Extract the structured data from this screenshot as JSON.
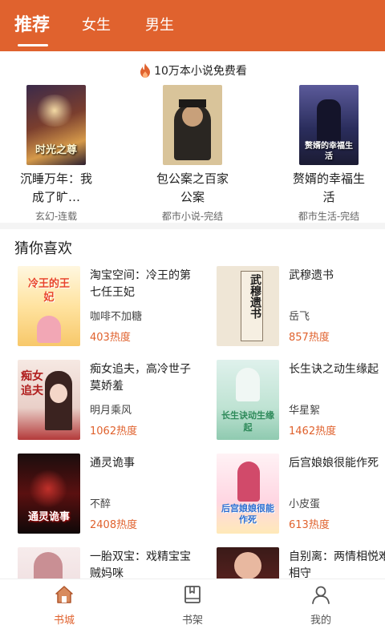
{
  "header": {
    "tabs": [
      {
        "label": "推荐",
        "active": true
      },
      {
        "label": "女生",
        "active": false
      },
      {
        "label": "男生",
        "active": false
      }
    ],
    "color": "#e0622e"
  },
  "promo": {
    "text": "10万本小说免费看",
    "icon": "flame-icon"
  },
  "featured": [
    {
      "title": "沉睡万年：我成了旷…",
      "meta": "玄幻-连载"
    },
    {
      "title": "包公案之百家公案",
      "meta": "都市小说-完结"
    },
    {
      "title": "赘婿的幸福生活",
      "meta": "都市生活-完结"
    }
  ],
  "section": {
    "title": "猜你喜欢"
  },
  "books": [
    {
      "title": "淘宝空间：冷王的第七任王妃",
      "author": "咖啡不加糖",
      "heat": "403热度"
    },
    {
      "title": "武穆遗书",
      "author": "岳飞",
      "heat": "857热度"
    },
    {
      "title": "痴女追夫，高冷世子莫娇羞",
      "author": "明月乘风",
      "heat": "1062热度"
    },
    {
      "title": "长生诀之动生缘起",
      "author": "华星絮",
      "heat": "1462热度"
    },
    {
      "title": "通灵诡事",
      "author": "不醉",
      "heat": "2408热度"
    },
    {
      "title": "后宫娘娘很能作死",
      "author": "小皮蛋",
      "heat": "613热度"
    },
    {
      "title": "一胎双宝：戏精宝宝贼妈咪",
      "author": "",
      "heat": ""
    },
    {
      "title": "自别离：两情相悦难相守",
      "author": "",
      "heat": ""
    }
  ],
  "cover_lettering": {
    "featured_1": "时光之尊",
    "featured_3": "赘婿的幸福生活",
    "book_1": "冷王的王妃",
    "book_2": "武穆遗书",
    "book_3": "痴女追夫",
    "book_4": "长生诀动生缘起",
    "book_5": "通灵诡事",
    "book_6": "后宫娘娘很能作死"
  },
  "nav": [
    {
      "label": "书城",
      "icon": "home-icon",
      "active": true
    },
    {
      "label": "书架",
      "icon": "bookshelf-icon",
      "active": false
    },
    {
      "label": "我的",
      "icon": "profile-icon",
      "active": false
    }
  ],
  "colors": {
    "accent": "#e0622e",
    "text": "#222222",
    "muted": "#666666",
    "nav_inactive": "#555555"
  }
}
